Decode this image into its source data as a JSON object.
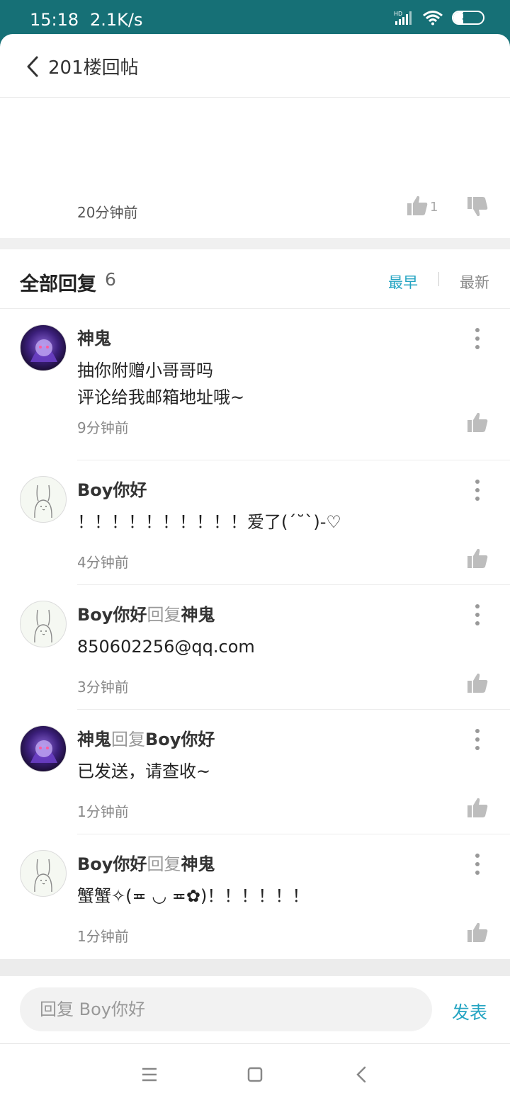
{
  "status_bar": {
    "time": "15:18",
    "speed": "2.1K/s",
    "battery": "34"
  },
  "top_bar": {
    "title": "201楼回帖"
  },
  "post": {
    "time": "20分钟前",
    "like_count": "1"
  },
  "replies_header": {
    "title": "全部回复",
    "count": "6",
    "sort_earliest": "最早",
    "sort_newest": "最新"
  },
  "reply_keyword": "回复",
  "replies": [
    {
      "author": "神鬼",
      "target": "",
      "text": "抽你附赠小哥哥吗\n评论给我邮箱地址哦~",
      "time": "9分钟前",
      "avatar": "dark-anime-avatar"
    },
    {
      "author": "Boy你好",
      "target": "",
      "text": "！！！！！！！！！！爱了(ˊ˘ˋ)-♡",
      "time": "4分钟前",
      "avatar": "bunny-sketch-avatar"
    },
    {
      "author": "Boy你好",
      "target": "神鬼",
      "text": "850602256@qq.com",
      "time": "3分钟前",
      "avatar": "bunny-sketch-avatar"
    },
    {
      "author": "神鬼",
      "target": "Boy你好",
      "text": "已发送，请查收~",
      "time": "1分钟前",
      "avatar": "dark-anime-avatar"
    },
    {
      "author": "Boy你好",
      "target": "神鬼",
      "text": "蟹蟹✧(≖ ◡ ≖✿)！！！！！！",
      "time": "1分钟前",
      "avatar": "bunny-sketch-avatar"
    }
  ],
  "input_bar": {
    "placeholder": "回复 Boy你好",
    "send_label": "发表"
  },
  "colors": {
    "status_bar": "#167076",
    "accent": "#24a4c2",
    "divider": "#f0f0f0"
  }
}
